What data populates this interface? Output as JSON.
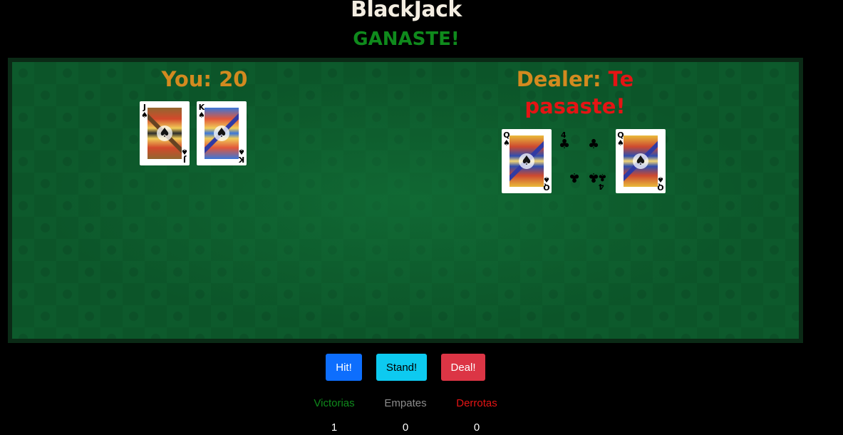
{
  "game": {
    "title": "BlackJack",
    "result": "GANASTE!"
  },
  "player": {
    "label": "You:",
    "score": "20",
    "cards": [
      {
        "rank": "J",
        "suit": "♠",
        "suit_name": "spades"
      },
      {
        "rank": "K",
        "suit": "♠",
        "suit_name": "spades"
      }
    ]
  },
  "dealer": {
    "label": "Dealer:",
    "status": "Te pasaste!",
    "cards": [
      {
        "rank": "Q",
        "suit": "♠",
        "suit_name": "spades"
      },
      {
        "rank": "4",
        "suit": "♣",
        "suit_name": "clubs"
      },
      {
        "rank": "Q",
        "suit": "♠",
        "suit_name": "spades"
      }
    ]
  },
  "controls": {
    "hit_label": "Hit!",
    "stand_label": "Stand!",
    "deal_label": "Deal!"
  },
  "stats": {
    "wins_label": "Victorias",
    "wins": "1",
    "ties_label": "Empates",
    "ties": "0",
    "losses_label": "Derrotas",
    "losses": "0"
  },
  "colors": {
    "background": "#000000",
    "table_green": "#0d5a2c",
    "heading_orange": "#d38a1f",
    "win_green": "#0f8a1c",
    "bust_red": "#e51414",
    "hit_blue": "#0d6efd",
    "stand_cyan": "#0dcaf0",
    "deal_red": "#dc3545"
  }
}
